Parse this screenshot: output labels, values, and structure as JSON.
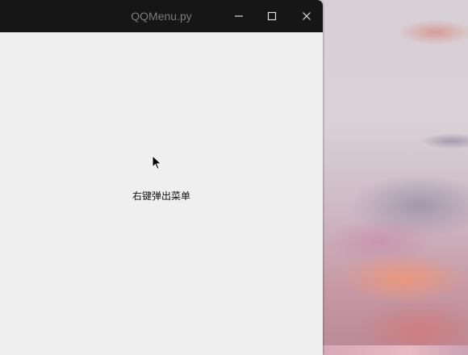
{
  "window": {
    "title": "QQMenu.py",
    "controls": {
      "minimize_icon": "minimize-icon",
      "maximize_icon": "maximize-icon",
      "close_icon": "close-icon"
    }
  },
  "content": {
    "hint_text": "右键弹出菜单"
  },
  "colors": {
    "titlebar_bg": "#161616",
    "title_text": "#7b7b7b",
    "window_bg": "#efefef",
    "text": "#111111"
  }
}
